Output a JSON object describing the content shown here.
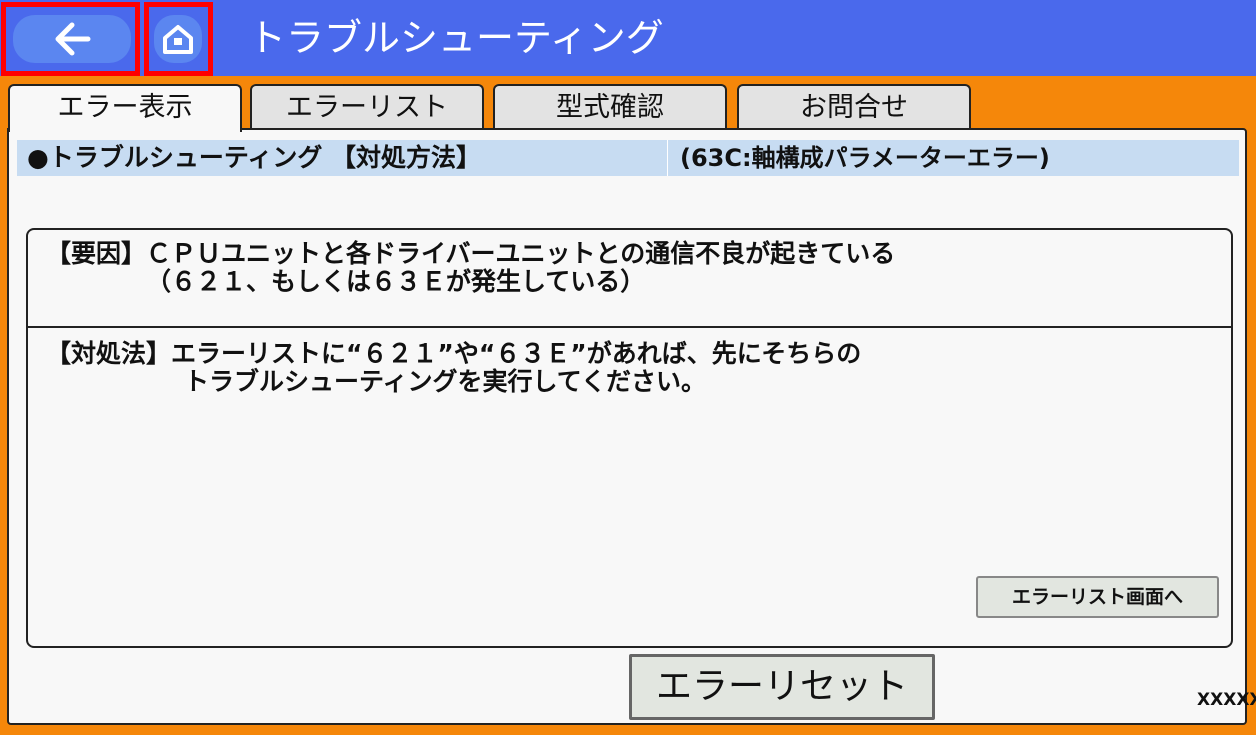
{
  "header": {
    "title": "トラブルシューティング",
    "back_icon": "arrow-left-icon",
    "home_icon": "home-icon"
  },
  "tabs": [
    {
      "label": "エラー表示",
      "active": true
    },
    {
      "label": "エラーリスト",
      "active": false
    },
    {
      "label": "型式確認",
      "active": false
    },
    {
      "label": "お問合せ",
      "active": false
    }
  ],
  "info": {
    "heading": "●トラブルシューティング 【対処方法】",
    "error_code": "(63C:軸構成パラメーターエラー)"
  },
  "cause": {
    "line1": "【要因】ＣＰＵユニットと各ドライバーユニットとの通信不良が起きている",
    "line2": "（６２１、もしくは６３Ｅが発生している）"
  },
  "remedy": {
    "line1": "【対処法】エラーリストに“６２１”や“６３Ｅ”があれば、先にそちらの",
    "line2": "トラブルシューティングを実行してください。"
  },
  "buttons": {
    "error_list_screen": "エラーリスト画面へ",
    "error_reset": "エラーリセット"
  },
  "footer_code": "XXXXX",
  "colors": {
    "header_bg": "#4a69ec",
    "frame_bg": "#f5870a",
    "highlight": "#ff0000",
    "info_bar": "#c7dcf2"
  }
}
